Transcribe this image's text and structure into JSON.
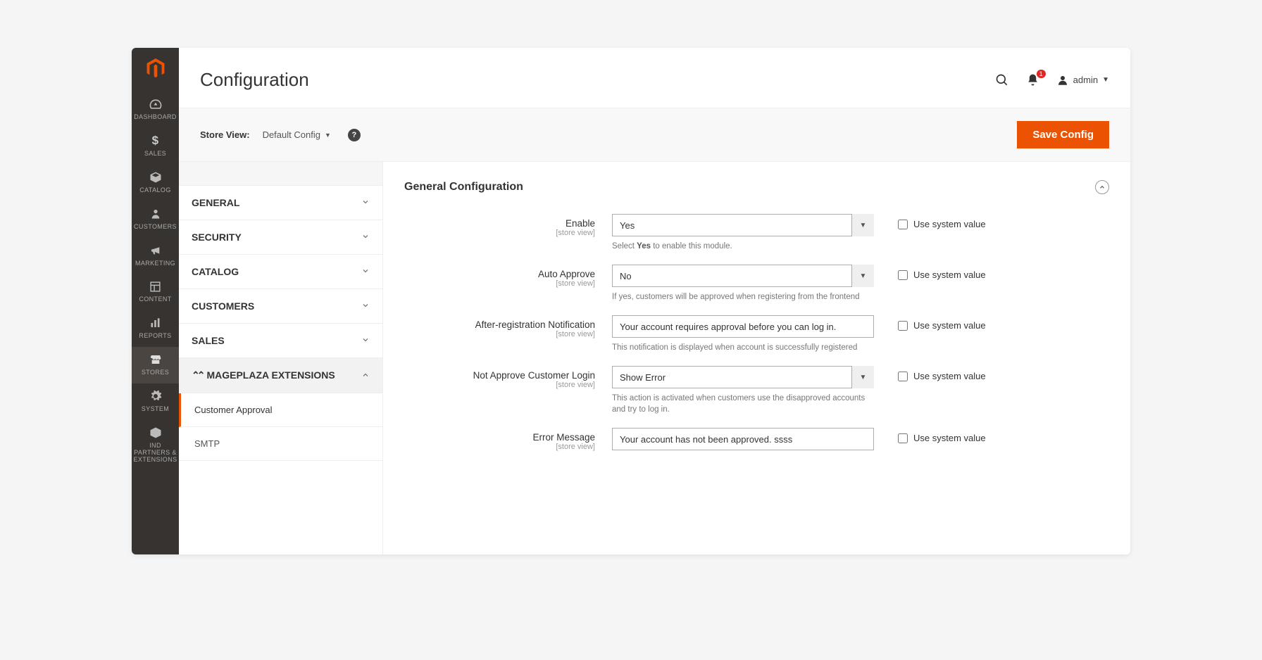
{
  "colors": {
    "accent": "#eb5202"
  },
  "rail": {
    "items": [
      {
        "label": "DASHBOARD"
      },
      {
        "label": "SALES"
      },
      {
        "label": "CATALOG"
      },
      {
        "label": "CUSTOMERS"
      },
      {
        "label": "MARKETING"
      },
      {
        "label": "CONTENT"
      },
      {
        "label": "REPORTS"
      },
      {
        "label": "STORES"
      },
      {
        "label": "SYSTEM"
      },
      {
        "label": "IND PARTNERS & EXTENSIONS"
      }
    ]
  },
  "header": {
    "title": "Configuration",
    "notifications_count": "1",
    "user_name": "admin"
  },
  "toolbar": {
    "store_view_label": "Store View:",
    "store_view_value": "Default Config",
    "save_label": "Save Config"
  },
  "tabs": {
    "groups": [
      {
        "label": "GENERAL"
      },
      {
        "label": "SECURITY"
      },
      {
        "label": "CATALOG"
      },
      {
        "label": "CUSTOMERS"
      },
      {
        "label": "SALES"
      },
      {
        "label": "MAGEPLAZA EXTENSIONS"
      }
    ],
    "sub": [
      {
        "label": "Customer Approval"
      },
      {
        "label": "SMTP"
      }
    ]
  },
  "section": {
    "title": "General Configuration",
    "use_system_label": "Use system value",
    "fields": {
      "enable": {
        "label": "Enable",
        "scope": "[store view]",
        "value": "Yes",
        "note_pre": "Select ",
        "note_bold": "Yes",
        "note_post": " to enable this module."
      },
      "auto_approve": {
        "label": "Auto Approve",
        "scope": "[store view]",
        "value": "No",
        "note": "If yes, customers will be approved when registering from the frontend"
      },
      "after_reg": {
        "label": "After-registration Notification",
        "scope": "[store view]",
        "value": "Your account requires approval before you can log in.",
        "note": "This notification is displayed when account is successfully registered"
      },
      "not_approve": {
        "label": "Not Approve Customer Login",
        "scope": "[store view]",
        "value": "Show Error",
        "note": "This action is activated when customers use the disapproved accounts and try to log in."
      },
      "error_msg": {
        "label": "Error Message",
        "scope": "[store view]",
        "value": "Your account has not been approved. ssss"
      }
    }
  }
}
